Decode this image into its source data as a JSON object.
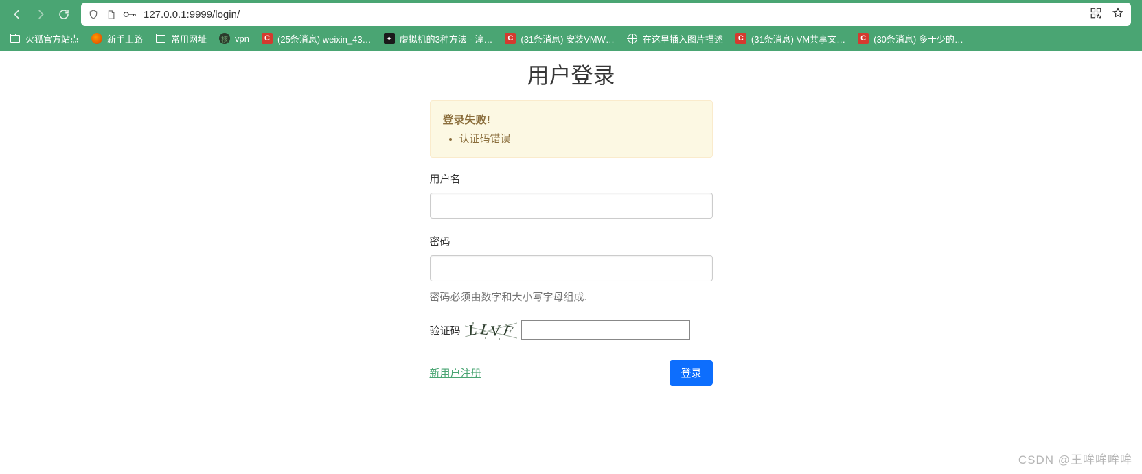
{
  "browser": {
    "url": "127.0.0.1:9999/login/"
  },
  "bookmarks": [
    {
      "label": "火狐官方站点",
      "icon": "folder"
    },
    {
      "label": "新手上路",
      "icon": "firefox"
    },
    {
      "label": "常用网址",
      "icon": "folder"
    },
    {
      "label": "vpn",
      "icon": "dark"
    },
    {
      "label": "(25条消息) weixin_43…",
      "icon": "c"
    },
    {
      "label": "虚拟机的3种方法 - 淳…",
      "icon": "bird"
    },
    {
      "label": "(31条消息) 安装VMW…",
      "icon": "c"
    },
    {
      "label": "在这里插入图片描述",
      "icon": "globe"
    },
    {
      "label": "(31条消息) VM共享文…",
      "icon": "c"
    },
    {
      "label": "(30条消息) 多于少的…",
      "icon": "c"
    }
  ],
  "login": {
    "title": "用户登录",
    "alert_title": "登录失败!",
    "alert_item": "认证码错误",
    "username_label": "用户名",
    "password_label": "密码",
    "password_hint": "密码必须由数字和大小写字母组成.",
    "captcha_label": "验证码",
    "captcha_text": "LLVF",
    "register_link": "新用户注册",
    "login_button": "登录"
  },
  "watermark": "CSDN @王哞哞哞哞"
}
